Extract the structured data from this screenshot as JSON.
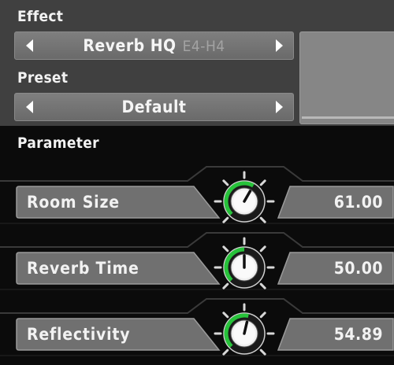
{
  "effect": {
    "label": "Effect",
    "name": "Reverb HQ",
    "range": "E4-H4"
  },
  "preset": {
    "label": "Preset",
    "name": "Default"
  },
  "parameters": {
    "header": "Parameter",
    "items": [
      {
        "name": "Room Size",
        "value": "61.00",
        "knob_level": 0.61
      },
      {
        "name": "Reverb Time",
        "value": "50.00",
        "knob_level": 0.5
      },
      {
        "name": "Reflectivity",
        "value": "54.89",
        "knob_level": 0.5489
      }
    ]
  },
  "colors": {
    "accent": "#27c23a",
    "panel": "#404040",
    "background": "#0b0b0b",
    "plate": "#6f6f6f",
    "text": "#f2f2f2"
  },
  "icons": {
    "prev": "triangle-left-icon",
    "next": "triangle-right-icon",
    "knob": "rotary-knob-icon"
  }
}
